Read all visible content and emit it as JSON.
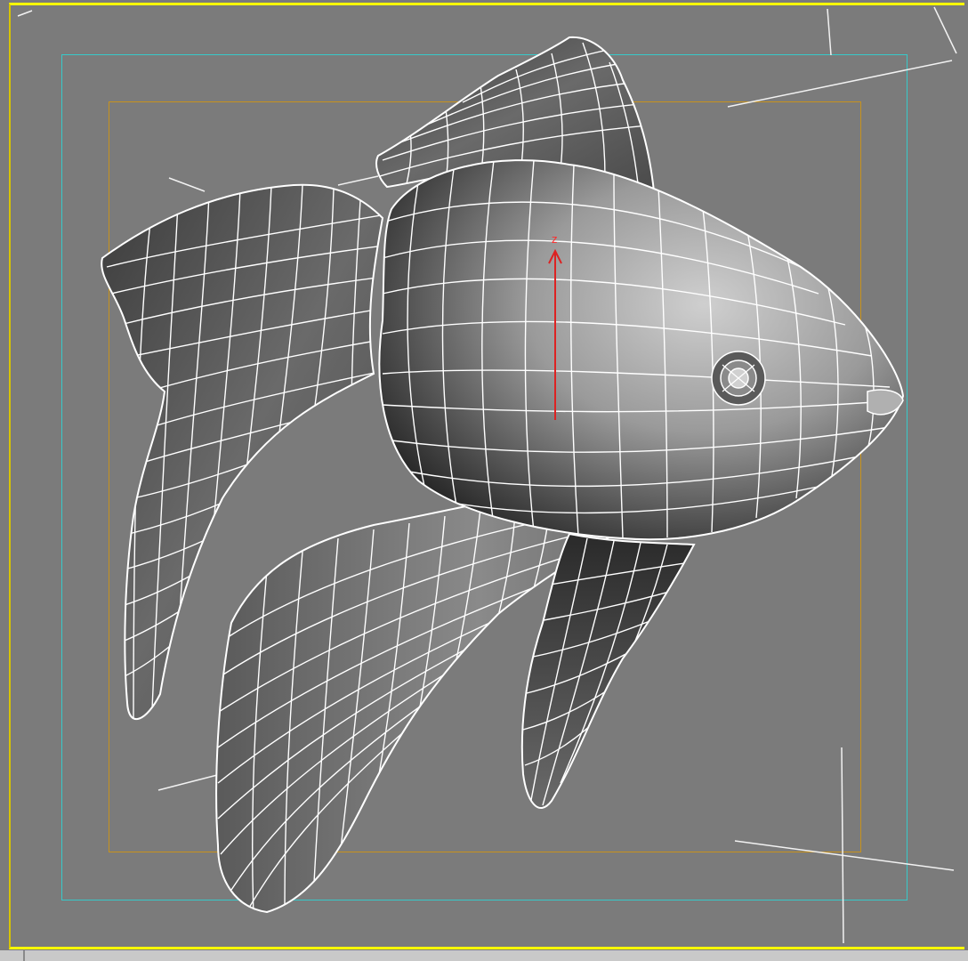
{
  "viewport": {
    "gizmo_axis_label": "z",
    "colors": {
      "background": "#7b7b7b",
      "viewport_border": "#ffff00",
      "safe_frame_outer": "#37c9c9",
      "safe_frame_inner": "#c8921c",
      "wireframe": "#ffffff",
      "gizmo_axis": "#dd2222"
    },
    "object_icon": "fish-mesh-icon"
  }
}
